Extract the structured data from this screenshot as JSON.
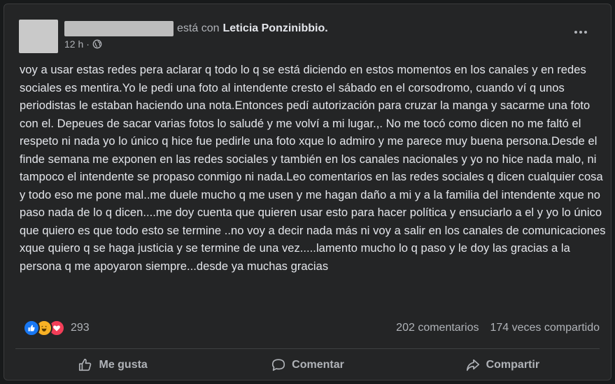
{
  "header": {
    "with_text": "está con",
    "tagged_name": "Leticia Ponzinibbio.",
    "time": "12 h",
    "separator": "·"
  },
  "post_body": "voy a usar estas redes pera aclarar q todo lo q se está diciendo en estos momentos en los canales y en redes sociales es mentira.Yo le pedi una foto al intendente cresto el sábado en el corsodromo, cuando ví q unos periodistas le estaban haciendo una nota.Entonces pedí autorización para cruzar la manga y sacarme una foto con el. Depeues de sacar varias fotos lo saludé y me volví a mi lugar.,. No me tocó como dicen no me faltó el respeto ni nada yo lo único q hice fue pedirle una foto xque lo admiro y me parece muy buena persona.Desde el finde semana me exponen en las redes sociales y también en los canales nacionales y yo no hice nada malo, ni tampoco el intendente se propaso  conmigo  ni nada.Leo comentarios en las redes sociales q dicen cualquier cosa y todo eso me pone mal..me duele mucho q me usen y me hagan daño a mi y a la familia del intendente xque no paso nada de lo q dicen....me doy cuenta que quieren usar esto para hacer política y ensuciarlo a el y yo lo único que quiero es que todo esto se termine ..no voy a decir nada más ni voy a salir en los canales de comunicaciones xque quiero q se haga justicia y se termine de una vez.....lamento mucho lo q paso y le doy las gracias a la persona q me apoyaron siempre...desde ya muchas gracias",
  "reactions": {
    "count": "293",
    "icons": [
      "like-icon",
      "haha-icon",
      "love-icon"
    ]
  },
  "stats": {
    "comments": "202 comentarios",
    "shares": "174 veces compartido"
  },
  "actions": {
    "like_label": "Me gusta",
    "comment_label": "Comentar",
    "share_label": "Compartir"
  },
  "colors": {
    "background": "#242526",
    "text_primary": "#e4e6eb",
    "text_secondary": "#b0b3b8",
    "like_blue": "#1877f2",
    "haha_yellow": "#f7b125",
    "love_red": "#f33e58"
  }
}
